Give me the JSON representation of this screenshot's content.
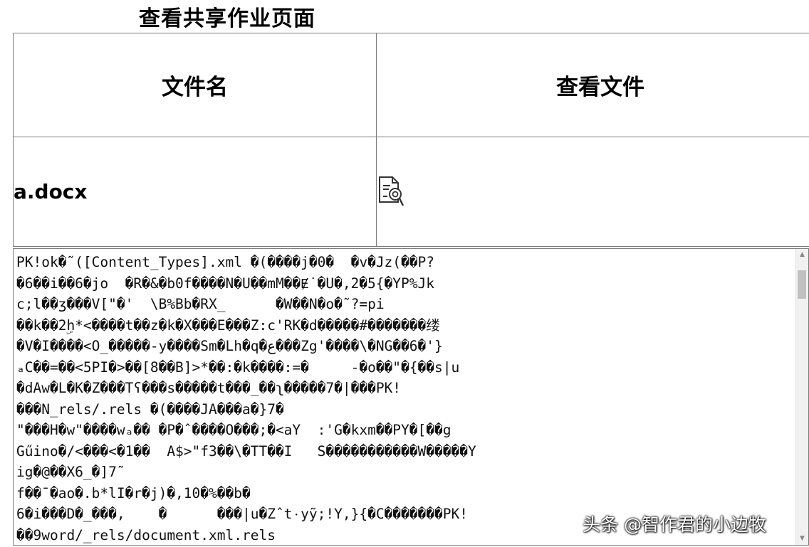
{
  "page_title": "查看共享作业页面",
  "table": {
    "headers": [
      "文件名",
      "查看文件"
    ],
    "rows": [
      {
        "file_name": "a.docx",
        "view_icon": "document-search-icon"
      }
    ]
  },
  "viewer": {
    "lines": [
      "PK!ok�˜([Content_Types].xml �(����j�0�  �v�Jz(��P?",
      "�6��i��6�jo  �R�&�b0f����N�U��mM��Ɇ˙�U�,2�5{�YP%Jk",
      "c;l��ʒ���V[\"�'  \\B%Bb�RX_      �W��N�o�˜?=pi",
      "��k��2ۣh*<����t��z�k�X���E���Z:c'RK�d�����#�������缕",
      "�V�I����<O_�����-y����Sm�Lh�q�ع���Zg'����\\�NG��6�'}",
      "ₐC��=��<5PI�>��[8��B]>*��:�k����:=�     -�o��\"�{��s|u",
      "�dAw�L�K�Z���Tʕ���s�����t���_��ʅ�����7�|���PK!",
      "���N_rels/.rels �(����JA���a�}7�",
      "\"���H�w\"����wₐ�� �P�ˆ����O���;�<aY  :'G�kxm��PY�[��g",
      "Gűino�/<���<�1��  A$>\"f3��\\�TT��I   S�����������W�����Y",
      "ig�@��X6_�]7˜",
      "f��¯�ao�.b*lI�r�j)�,10�%��b�",
      "6�i���D�_���,    �      ���|u�Zˆt۰yỹ;!Y,}{�C�������PK!",
      "��9word/_rels/document.xml.rels"
    ]
  },
  "watermark": "头条 @智作君的小边牧"
}
